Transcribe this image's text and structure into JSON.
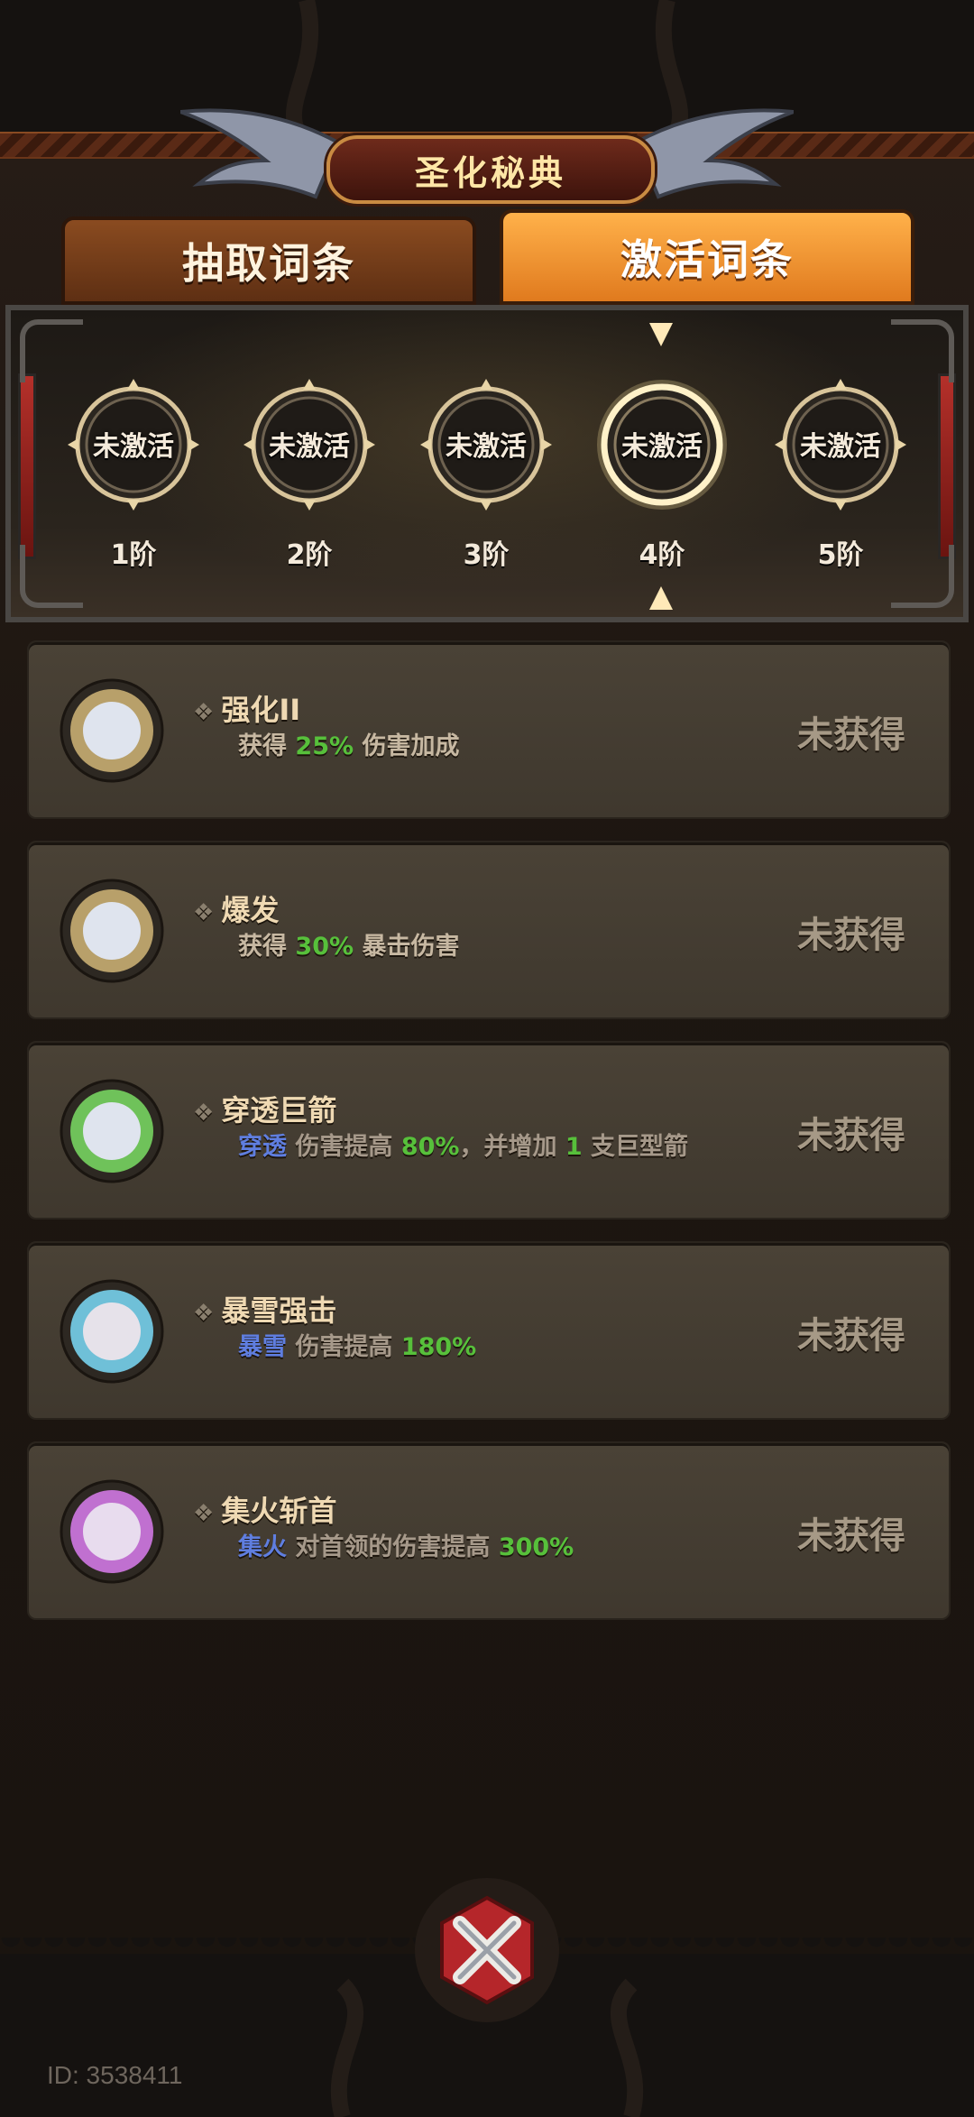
{
  "title": "圣化秘典",
  "tabs": [
    {
      "label": "抽取词条",
      "active": false
    },
    {
      "label": "激活词条",
      "active": true
    }
  ],
  "tiers": [
    {
      "status": "未激活",
      "label": "1阶"
    },
    {
      "status": "未激活",
      "label": "2阶"
    },
    {
      "status": "未激活",
      "label": "3阶"
    },
    {
      "status": "未激活",
      "label": "4阶",
      "selected": true
    },
    {
      "status": "未激活",
      "label": "5阶"
    }
  ],
  "entries": [
    {
      "name": "强化II",
      "desc_pre": "获得 ",
      "desc_num": "25%",
      "desc_post": " 伤害加成",
      "state": "未获得",
      "orb_color": "#b8a06a"
    },
    {
      "name": "爆发",
      "desc_pre": "获得 ",
      "desc_num": "30%",
      "desc_post": " 暴击伤害",
      "state": "未获得",
      "orb_color": "#b8a06a"
    },
    {
      "name": "穿透巨箭",
      "desc_tag": "穿透",
      "desc_mid1": " 伤害提高 ",
      "desc_num": "80%",
      "desc_mid2": "，并增加 ",
      "desc_num2": "1",
      "desc_post": " 支巨型箭",
      "state": "未获得",
      "orb_color": "#6fc25a"
    },
    {
      "name": "暴雪强击",
      "desc_tag": "暴雪",
      "desc_mid1": " 伤害提高 ",
      "desc_num": "180%",
      "state": "未获得",
      "orb_color": "#6fc0d8"
    },
    {
      "name": "集火斩首",
      "desc_tag": "集火",
      "desc_mid1": " 对首领的伤害提高 ",
      "desc_num": "300%",
      "state": "未获得",
      "orb_color": "#c070d0"
    }
  ],
  "footer": {
    "id_text": "ID: 3538411",
    "close_icon": "close-x-icon"
  }
}
